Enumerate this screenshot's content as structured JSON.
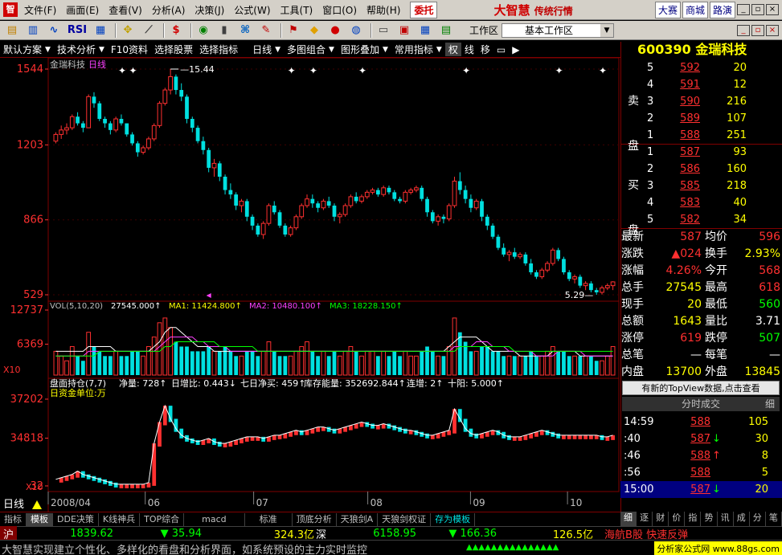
{
  "window": {
    "app_icon": "app-logo-icon",
    "brand_name": "大智慧",
    "brand_sub": "传统行情"
  },
  "menu": [
    "文件(F)",
    "画面(E)",
    "查看(V)",
    "分析(A)",
    "决策(J)",
    "公式(W)",
    "工具(T)",
    "窗口(O)",
    "帮助(H)"
  ],
  "menu_buttons": {
    "order": "委托",
    "contest": "大赛",
    "mall": "商城",
    "route": "路演"
  },
  "toolbar": {
    "rsi": "RSI",
    "dollar": "$",
    "workarea_label": "工作区",
    "workarea_value": "基本工作区"
  },
  "chart_toolbar": {
    "items": [
      "默认方案",
      "技术分析",
      "F10资料",
      "选择股票",
      "选择指标",
      "日线",
      "多图组合",
      "图形叠加",
      "常用指标"
    ],
    "tools": [
      "权",
      "线",
      "移"
    ]
  },
  "stock": {
    "code": "600390",
    "name": "金瑞科技",
    "title_label": "金瑞科技",
    "period": "日线"
  },
  "colors": {
    "up": "#ff3030",
    "down": "#00e0e0",
    "ma1": "#ffffff",
    "ma2": "#ff40ff",
    "ma3": "#00ff00",
    "cumline": "#ffffff"
  },
  "price_axis": {
    "ticks": [
      "1544",
      "1203",
      "866",
      "529"
    ],
    "max_label": "15.44",
    "min_label": "5.29"
  },
  "volume_panel": {
    "legend": {
      "title": "VOL(5,10,20)",
      "vol": "27545.000",
      "ma1": "MA1: 11424.800",
      "ma2": "MA2: 10480.100",
      "ma3": "MA3: 18228.150"
    },
    "ticks": [
      "12737",
      "6369"
    ],
    "unit": "X10"
  },
  "fund_panel": {
    "legend": {
      "title": "盘面持仓(7,7)",
      "items": [
        "净量: 728",
        "日增比: 0.443",
        "七日净买: 459",
        "库存能量: 352692.844",
        "连增: 2",
        "十阳: 5.000"
      ]
    },
    "subtitle": "日资金单位:万",
    "ticks": [
      "37202",
      "34818",
      "32"
    ],
    "unit": "X10"
  },
  "date_axis": {
    "labels": [
      "2008/04",
      "06",
      "07",
      "08",
      "09",
      "10"
    ],
    "period_label": "日线"
  },
  "chart_data": {
    "type": "candlestick",
    "price_ylim": [
      5.29,
      15.44
    ],
    "candles": [
      [
        12.2,
        12.6,
        12.1,
        12.5
      ],
      [
        12.5,
        12.9,
        12.3,
        12.7
      ],
      [
        12.7,
        13.0,
        12.5,
        12.8
      ],
      [
        12.8,
        13.4,
        12.7,
        13.3
      ],
      [
        13.3,
        13.5,
        12.9,
        13.0
      ],
      [
        13.0,
        13.1,
        12.6,
        12.8
      ],
      [
        12.8,
        14.3,
        12.8,
        14.2
      ],
      [
        14.2,
        14.4,
        13.7,
        13.9
      ],
      [
        13.9,
        14.0,
        13.1,
        13.2
      ],
      [
        13.2,
        13.3,
        12.8,
        13.0
      ],
      [
        13.0,
        13.1,
        12.5,
        12.7
      ],
      [
        12.7,
        13.3,
        12.6,
        13.2
      ],
      [
        13.2,
        13.4,
        12.9,
        13.0
      ],
      [
        13.0,
        13.0,
        12.4,
        12.5
      ],
      [
        12.5,
        12.6,
        12.0,
        12.1
      ],
      [
        12.1,
        12.2,
        11.5,
        11.7
      ],
      [
        11.7,
        12.0,
        11.6,
        11.9
      ],
      [
        11.9,
        12.4,
        11.8,
        12.3
      ],
      [
        12.3,
        13.0,
        12.2,
        12.9
      ],
      [
        12.9,
        14.0,
        12.8,
        13.9
      ],
      [
        13.9,
        14.6,
        13.8,
        14.5
      ],
      [
        14.5,
        15.44,
        14.3,
        15.1
      ],
      [
        15.1,
        15.2,
        14.3,
        14.5
      ],
      [
        14.5,
        14.8,
        14.0,
        14.2
      ],
      [
        14.2,
        14.3,
        13.0,
        13.2
      ],
      [
        13.2,
        13.3,
        12.6,
        12.8
      ],
      [
        12.8,
        12.9,
        12.1,
        12.2
      ],
      [
        12.2,
        12.4,
        11.6,
        11.8
      ],
      [
        11.8,
        11.9,
        10.8,
        11.0
      ],
      [
        11.0,
        11.4,
        10.6,
        11.2
      ],
      [
        11.2,
        11.3,
        10.4,
        10.6
      ],
      [
        10.6,
        10.7,
        9.8,
        10.0
      ],
      [
        10.0,
        10.3,
        9.6,
        9.8
      ],
      [
        9.8,
        9.9,
        9.1,
        9.3
      ],
      [
        9.3,
        9.6,
        9.0,
        9.5
      ],
      [
        9.5,
        9.6,
        8.6,
        8.8
      ],
      [
        8.8,
        8.9,
        8.2,
        8.4
      ],
      [
        8.4,
        8.5,
        7.9,
        8.0
      ],
      [
        8.0,
        8.6,
        7.8,
        8.5
      ],
      [
        8.5,
        9.4,
        8.4,
        9.3
      ],
      [
        9.3,
        9.5,
        8.9,
        9.0
      ],
      [
        9.0,
        9.1,
        8.3,
        8.4
      ],
      [
        8.4,
        8.5,
        7.9,
        8.0
      ],
      [
        8.0,
        8.4,
        7.9,
        8.3
      ],
      [
        8.3,
        8.9,
        8.2,
        8.8
      ],
      [
        8.8,
        9.4,
        8.7,
        9.3
      ],
      [
        9.3,
        9.8,
        9.2,
        9.6
      ],
      [
        9.6,
        9.8,
        9.2,
        9.4
      ],
      [
        9.4,
        9.5,
        9.0,
        9.2
      ],
      [
        9.2,
        9.6,
        9.1,
        9.5
      ],
      [
        9.5,
        9.7,
        9.2,
        9.3
      ],
      [
        9.3,
        9.4,
        8.6,
        8.8
      ],
      [
        8.8,
        9.0,
        8.5,
        8.9
      ],
      [
        8.9,
        9.4,
        8.8,
        9.3
      ],
      [
        9.3,
        9.8,
        9.2,
        9.7
      ],
      [
        9.7,
        9.9,
        9.4,
        9.5
      ],
      [
        9.5,
        9.8,
        9.4,
        9.7
      ],
      [
        9.7,
        10.0,
        9.6,
        9.9
      ],
      [
        9.9,
        10.1,
        9.8,
        10.0
      ],
      [
        10.0,
        10.1,
        9.7,
        9.8
      ],
      [
        9.8,
        10.2,
        9.7,
        10.1
      ],
      [
        10.1,
        10.2,
        9.8,
        9.9
      ],
      [
        9.9,
        10.0,
        9.5,
        9.6
      ],
      [
        9.6,
        9.7,
        9.4,
        9.5
      ],
      [
        9.5,
        10.0,
        9.4,
        9.9
      ],
      [
        9.9,
        10.1,
        9.8,
        10.0
      ],
      [
        10.0,
        10.2,
        9.9,
        10.1
      ],
      [
        10.1,
        10.2,
        9.5,
        9.6
      ],
      [
        9.6,
        9.7,
        8.8,
        9.0
      ],
      [
        9.0,
        9.1,
        8.5,
        8.6
      ],
      [
        8.6,
        8.9,
        8.4,
        8.8
      ],
      [
        8.8,
        8.9,
        8.5,
        8.7
      ],
      [
        8.7,
        9.4,
        8.6,
        9.3
      ],
      [
        9.3,
        10.6,
        9.2,
        10.4
      ],
      [
        10.4,
        10.8,
        9.8,
        10.0
      ],
      [
        10.0,
        10.2,
        9.4,
        9.6
      ],
      [
        9.6,
        9.8,
        9.0,
        9.2
      ],
      [
        9.2,
        9.6,
        9.1,
        9.5
      ],
      [
        9.5,
        9.6,
        8.6,
        8.8
      ],
      [
        8.8,
        8.9,
        8.2,
        8.4
      ],
      [
        8.4,
        8.5,
        7.8,
        7.9
      ],
      [
        7.9,
        8.0,
        7.3,
        7.4
      ],
      [
        7.4,
        7.6,
        7.0,
        7.1
      ],
      [
        7.1,
        7.3,
        6.8,
        7.2
      ],
      [
        7.2,
        7.4,
        6.9,
        7.0
      ],
      [
        7.0,
        7.2,
        6.9,
        7.1
      ],
      [
        7.1,
        7.2,
        6.6,
        6.7
      ],
      [
        6.7,
        6.9,
        6.2,
        6.3
      ],
      [
        6.3,
        6.4,
        6.0,
        6.1
      ],
      [
        6.1,
        6.5,
        6.0,
        6.4
      ],
      [
        6.4,
        6.8,
        6.3,
        6.7
      ],
      [
        6.7,
        7.4,
        6.6,
        7.3
      ],
      [
        7.3,
        7.4,
        6.8,
        6.9
      ],
      [
        6.9,
        7.0,
        6.2,
        6.3
      ],
      [
        6.3,
        6.4,
        5.9,
        6.0
      ],
      [
        6.0,
        6.2,
        5.8,
        6.1
      ],
      [
        6.1,
        6.2,
        5.6,
        5.7
      ],
      [
        5.7,
        5.9,
        5.5,
        5.8
      ],
      [
        5.8,
        5.9,
        5.4,
        5.5
      ],
      [
        5.5,
        5.6,
        5.29,
        5.4
      ],
      [
        5.4,
        5.7,
        5.3,
        5.6
      ],
      [
        5.6,
        5.8,
        5.5,
        5.7
      ],
      [
        5.7,
        5.9,
        5.5,
        5.87
      ]
    ],
    "volumes": [
      5,
      4,
      3,
      6,
      4,
      3,
      9,
      6,
      5,
      4,
      4,
      5,
      4,
      4,
      5,
      5,
      4,
      6,
      8,
      11,
      12,
      10,
      7,
      6,
      6,
      5,
      5,
      5,
      6,
      5,
      5,
      6,
      5,
      4,
      4,
      5,
      5,
      4,
      5,
      7,
      5,
      4,
      4,
      4,
      5,
      6,
      7,
      5,
      4,
      5,
      4,
      5,
      4,
      5,
      6,
      5,
      4,
      5,
      5,
      4,
      5,
      4,
      5,
      4,
      5,
      4,
      4,
      5,
      6,
      5,
      4,
      4,
      6,
      12,
      9,
      7,
      5,
      5,
      6,
      6,
      5,
      5,
      4,
      4,
      4,
      4,
      4,
      5,
      4,
      4,
      5,
      6,
      5,
      5,
      4,
      4,
      4,
      4,
      4,
      3,
      3,
      4,
      6
    ],
    "ma1": [
      5,
      5,
      5,
      5,
      5,
      5,
      6,
      6,
      6,
      6,
      6,
      5,
      5,
      5,
      5,
      5,
      5,
      5,
      6,
      7,
      9,
      10,
      10,
      9,
      8,
      7,
      6,
      6,
      6,
      5,
      5,
      5,
      5,
      5,
      5,
      5,
      5,
      5,
      5,
      5,
      5,
      5,
      5,
      5,
      5,
      5,
      5,
      5,
      5,
      5,
      5,
      5,
      5,
      5,
      5,
      5,
      5,
      5,
      5,
      5,
      5,
      5,
      5,
      5,
      5,
      5,
      5,
      5,
      5,
      5,
      5,
      5,
      6,
      7,
      8,
      8,
      8,
      8,
      7,
      6,
      5,
      5,
      5,
      5,
      5,
      4,
      4,
      4,
      4,
      4,
      4,
      5,
      5,
      5,
      5,
      5,
      4,
      4,
      4,
      4,
      4,
      4,
      4
    ],
    "ma2": [
      4,
      4,
      4,
      4,
      4,
      4,
      5,
      5,
      5,
      5,
      5,
      5,
      5,
      5,
      5,
      5,
      5,
      5,
      5,
      6,
      7,
      8,
      8,
      8,
      8,
      8,
      7,
      7,
      6,
      6,
      6,
      6,
      5,
      5,
      5,
      5,
      5,
      5,
      5,
      5,
      5,
      5,
      5,
      5,
      5,
      5,
      5,
      5,
      5,
      5,
      5,
      5,
      5,
      5,
      5,
      5,
      5,
      5,
      5,
      5,
      5,
      5,
      5,
      5,
      5,
      5,
      5,
      5,
      5,
      5,
      5,
      5,
      5,
      6,
      6,
      6,
      6,
      7,
      7,
      7,
      6,
      6,
      6,
      5,
      5,
      5,
      5,
      5,
      4,
      4,
      4,
      4,
      5,
      5,
      5,
      5,
      5,
      4,
      4,
      4,
      4,
      4,
      4
    ],
    "ma3": [
      4,
      4,
      4,
      4,
      4,
      4,
      4,
      4,
      5,
      5,
      5,
      5,
      5,
      5,
      5,
      5,
      5,
      5,
      5,
      5,
      6,
      6,
      7,
      7,
      7,
      7,
      7,
      7,
      7,
      7,
      6,
      6,
      6,
      6,
      6,
      6,
      6,
      5,
      5,
      5,
      5,
      5,
      5,
      5,
      5,
      5,
      5,
      5,
      5,
      5,
      5,
      5,
      5,
      5,
      5,
      5,
      5,
      5,
      5,
      5,
      5,
      5,
      5,
      5,
      5,
      5,
      5,
      5,
      5,
      5,
      5,
      5,
      5,
      5,
      6,
      6,
      6,
      6,
      6,
      6,
      6,
      6,
      6,
      6,
      5,
      5,
      5,
      5,
      5,
      5,
      5,
      5,
      5,
      5,
      5,
      5,
      5,
      5,
      5,
      5,
      5,
      5,
      5
    ],
    "fund": [
      32.3,
      32.4,
      32.5,
      32.6,
      32.8,
      32.6,
      32.5,
      32.4,
      32.3,
      32.2,
      32.1,
      32.0,
      32.0,
      32.0,
      32.0,
      32.0,
      32.0,
      32.1,
      34.5,
      35.8,
      36.8,
      36.0,
      35.4,
      35.0,
      34.8,
      34.7,
      34.6,
      34.7,
      34.8,
      34.6,
      34.5,
      34.5,
      34.6,
      34.7,
      34.8,
      34.9,
      34.9,
      34.9,
      34.8,
      34.9,
      35.0,
      35.0,
      35.1,
      35.2,
      35.3,
      35.2,
      35.3,
      35.4,
      35.5,
      35.5,
      35.4,
      35.3,
      35.4,
      35.5,
      35.6,
      35.7,
      35.8,
      35.7,
      35.6,
      35.6,
      35.7,
      35.6,
      35.5,
      35.4,
      35.3,
      35.3,
      35.2,
      35.1,
      35.0,
      35.0,
      35.1,
      35.2,
      35.3,
      36.6,
      36.0,
      35.4,
      35.1,
      35.0,
      35.1,
      35.2,
      35.3,
      35.2,
      35.0,
      34.9,
      34.9,
      34.9,
      35.0,
      35.1,
      35.2,
      35.3,
      35.2,
      35.1,
      35.0,
      35.0,
      35.0,
      35.0,
      35.0,
      35.0,
      35.0,
      35.0,
      34.9,
      34.9,
      35.0
    ]
  },
  "orderbook": {
    "sell_label": "卖盘",
    "buy_label": "买盘",
    "sell": [
      {
        "lvl": "5",
        "price": "592",
        "vol": "20"
      },
      {
        "lvl": "4",
        "price": "591",
        "vol": "12"
      },
      {
        "lvl": "3",
        "price": "590",
        "vol": "216"
      },
      {
        "lvl": "2",
        "price": "589",
        "vol": "107"
      },
      {
        "lvl": "1",
        "price": "588",
        "vol": "251"
      }
    ],
    "buy": [
      {
        "lvl": "1",
        "price": "587",
        "vol": "93"
      },
      {
        "lvl": "2",
        "price": "586",
        "vol": "160"
      },
      {
        "lvl": "3",
        "price": "585",
        "vol": "218"
      },
      {
        "lvl": "4",
        "price": "583",
        "vol": "40"
      },
      {
        "lvl": "5",
        "price": "582",
        "vol": "34"
      }
    ]
  },
  "quotes": [
    {
      "l": "最新",
      "v": "587",
      "c": "#ff3030",
      "l2": "均价",
      "v2": "596",
      "c2": "#ff3030"
    },
    {
      "l": "涨跌",
      "v": "▲024",
      "c": "#ff3030",
      "l2": "换手",
      "v2": "2.93%",
      "c2": "#ffff00"
    },
    {
      "l": "涨幅",
      "v": "4.26%",
      "c": "#ff3030",
      "l2": "今开",
      "v2": "568",
      "c2": "#ff3030"
    },
    {
      "l": "总手",
      "v": "27545",
      "c": "#ffff00",
      "l2": "最高",
      "v2": "618",
      "c2": "#ff3030"
    },
    {
      "l": "现手",
      "v": "20",
      "c": "#ffff00",
      "l2": "最低",
      "v2": "560",
      "c2": "#00ff00"
    },
    {
      "l": "总额",
      "v": "1643",
      "c": "#ffff00",
      "l2": "量比",
      "v2": "3.71",
      "c2": "#ffffff"
    },
    {
      "l": "涨停",
      "v": "619",
      "c": "#ff3030",
      "l2": "跌停",
      "v2": "507",
      "c2": "#00ff00"
    },
    {
      "l": "总笔",
      "v": "—",
      "c": "#ffffff",
      "l2": "每笔",
      "v2": "—",
      "c2": "#ffffff"
    },
    {
      "l": "内盘",
      "v": "13700",
      "c": "#ffff00",
      "l2": "外盘",
      "v2": "13845",
      "c2": "#ffff00"
    }
  ],
  "topview_text": "有新的TopView数据,点击查看",
  "tick_header": {
    "title": "分时成交",
    "detail": "细"
  },
  "ticks": [
    {
      "t": "14:59",
      "p": "588",
      "a": "",
      "v": "105",
      "c": "#ff3030"
    },
    {
      "t": ":40",
      "p": "587",
      "a": "↓",
      "v": "30",
      "c": "#ff3030"
    },
    {
      "t": ":46",
      "p": "588",
      "a": "↑",
      "v": "8",
      "c": "#ff3030"
    },
    {
      "t": ":56",
      "p": "588",
      "a": "",
      "v": "5",
      "c": "#ff3030"
    },
    {
      "t": "15:00",
      "p": "587",
      "a": "↓",
      "v": "20",
      "c": "#ff3030"
    }
  ],
  "bottom_tabs": [
    "指标",
    "模板",
    "DDE决策",
    "K线神兵",
    "TOP综合",
    "macd",
    "标准",
    "顶底分析",
    "天狼剑A",
    "天狼剑权证",
    "存为模板"
  ],
  "side_tabs": [
    "细",
    "逐",
    "财",
    "价",
    "指",
    "势",
    "讯",
    "成",
    "分",
    "笔"
  ],
  "index_row": {
    "sh_label": "沪",
    "sh_value": "1839.62",
    "sh_change": "▼ 35.94",
    "sh_amount": "324.3亿",
    "sz_label": "深",
    "sz_value": "6158.95",
    "sz_change": "▼ 166.36",
    "sz_amount": "126.5亿",
    "news": "海航B股 快速反弹"
  },
  "status": {
    "marquee": "大智慧实现建立个性化、多样化的看盘和分析界面，如系统预设的主力实时监控",
    "site": "分析家公式网 www.88gs.com"
  }
}
